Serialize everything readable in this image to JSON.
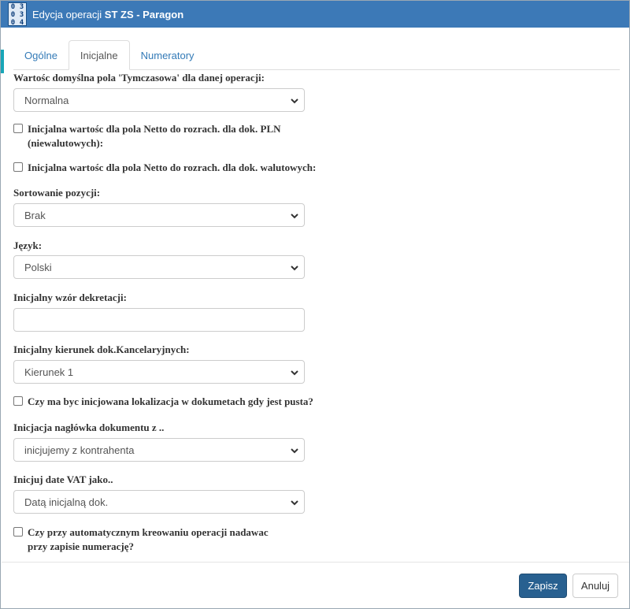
{
  "window": {
    "title_prefix": "Edycja operacji ",
    "title_bold": "ST ZS - Paragon",
    "icon_chars": [
      "0",
      "3",
      "0",
      "3",
      "0",
      "4"
    ]
  },
  "tabs": [
    {
      "label": "Ogólne",
      "active": false
    },
    {
      "label": "Inicjalne",
      "active": true
    },
    {
      "label": "Numeratory",
      "active": false
    }
  ],
  "form": {
    "tymczasowa_label": "Wartośc domyślna pola 'Tymczasowa' dla danej operacji:",
    "tymczasowa_value": "Normalna",
    "netto_pln_label": "Inicjalna wartośc dla pola Netto do rozrach. dla dok. PLN (niewalutowych):",
    "netto_pln_checked": false,
    "netto_wal_label": "Inicjalna wartośc dla pola Netto do rozrach. dla dok. walutowych:",
    "netto_wal_checked": false,
    "sortowanie_label": "Sortowanie pozycji:",
    "sortowanie_value": "Brak",
    "jezyk_label": "Język:",
    "jezyk_value": "Polski",
    "wzor_label": "Inicjalny wzór dekretacji:",
    "wzor_value": "",
    "kierunek_label": "Inicjalny kierunek dok.Kancelaryjnych:",
    "kierunek_value": "Kierunek 1",
    "lokalizacja_label": "Czy ma byc inicjowana lokalizacja w dokumetach gdy jest pusta?",
    "lokalizacja_checked": false,
    "naglowek_label": "Inicjacja nagłówka dokumentu z ..",
    "naglowek_value": "inicjujemy z kontrahenta",
    "datavat_label": "Inicjuj date VAT jako..",
    "datavat_value": "Datą inicjalną dok.",
    "numeracja_label": "Czy przy automatycznym kreowaniu operacji nadawac przy zapisie numerację?",
    "numeracja_checked": false
  },
  "footer": {
    "save_label": "Zapisz",
    "cancel_label": "Anuluj"
  },
  "colors": {
    "titlebar": "#3c79b7",
    "primary": "#286090",
    "link": "#337ab7"
  }
}
